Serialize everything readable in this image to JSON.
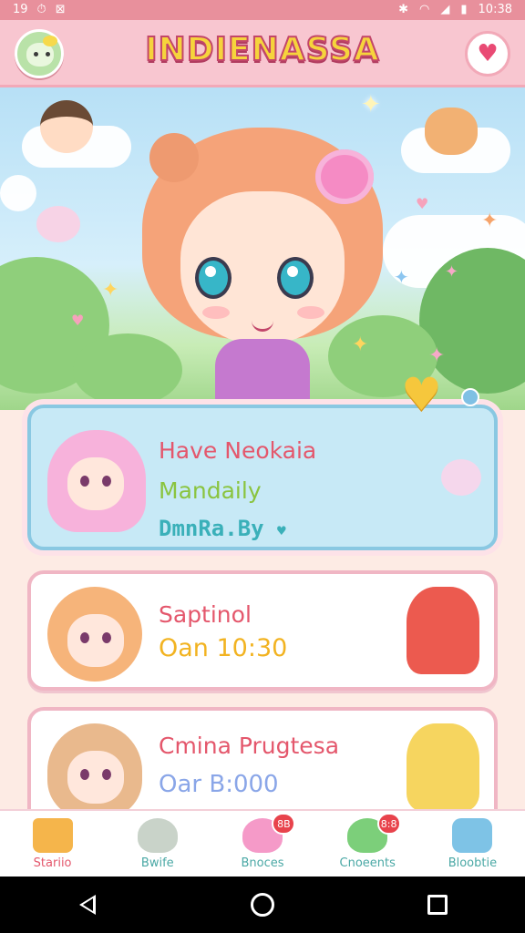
{
  "status_bar": {
    "left_items": [
      "19",
      "⏱",
      "⊠"
    ],
    "time": "10:38"
  },
  "header": {
    "title": "INDIENASSA",
    "logo_icon": "cat-mascot-icon",
    "favorite_icon": "heart-icon"
  },
  "list": {
    "items": [
      {
        "title": "Have Neokaia",
        "subtitle": "Mandaily",
        "meta": "DmnRa.By",
        "meta_icon": "small-heart-icon",
        "active": true
      },
      {
        "title": "Saptinol",
        "subtitle": "Oan 10:30"
      },
      {
        "title": "Cmina Prugtesa",
        "subtitle": "Oar B:000"
      }
    ]
  },
  "bottom_nav": {
    "items": [
      {
        "label": "Stariio",
        "icon": "house-icon",
        "active": true
      },
      {
        "label": "Bwife",
        "icon": "cat-icon"
      },
      {
        "label": "Bnoces",
        "icon": "pink-pet-icon",
        "badge": "8B"
      },
      {
        "label": "Cnoeents",
        "icon": "green-pet-icon",
        "badge": "8:8"
      },
      {
        "label": "Bloobtie",
        "icon": "menu-list-icon"
      }
    ]
  },
  "colors": {
    "accent": "#e4576c",
    "header_bg": "#f8c6d0",
    "active_card": "#c7e9f6"
  }
}
